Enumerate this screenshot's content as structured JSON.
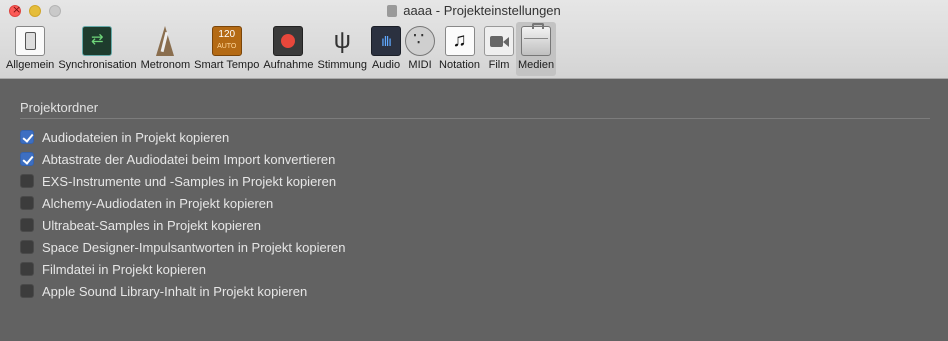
{
  "window": {
    "title": "aaaa - Projekteinstellungen"
  },
  "toolbar": {
    "items": [
      {
        "label": "Allgemein",
        "icon": "general-switch-icon",
        "selected": false
      },
      {
        "label": "Synchronisation",
        "icon": "sync-arrows-icon",
        "selected": false
      },
      {
        "label": "Metronom",
        "icon": "metronome-icon",
        "selected": false
      },
      {
        "label": "Smart Tempo",
        "icon": "smart-tempo-icon",
        "selected": false,
        "badge": "120",
        "badge_sub": "AUTO"
      },
      {
        "label": "Aufnahme",
        "icon": "record-icon",
        "selected": false
      },
      {
        "label": "Stimmung",
        "icon": "tuning-fork-icon",
        "selected": false
      },
      {
        "label": "Audio",
        "icon": "waveform-icon",
        "selected": false
      },
      {
        "label": "MIDI",
        "icon": "midi-connector-icon",
        "selected": false
      },
      {
        "label": "Notation",
        "icon": "music-note-icon",
        "selected": false
      },
      {
        "label": "Film",
        "icon": "camera-icon",
        "selected": false
      },
      {
        "label": "Medien",
        "icon": "briefcase-icon",
        "selected": true
      }
    ]
  },
  "section": {
    "title": "Projektordner",
    "options": [
      {
        "label": "Audiodateien in Projekt kopieren",
        "checked": true
      },
      {
        "label": "Abtastrate der Audiodatei beim Import konvertieren",
        "checked": true
      },
      {
        "label": "EXS-Instrumente und -Samples in Projekt kopieren",
        "checked": false
      },
      {
        "label": "Alchemy-Audiodaten in Projekt kopieren",
        "checked": false
      },
      {
        "label": "Ultrabeat-Samples in Projekt kopieren",
        "checked": false
      },
      {
        "label": "Space Designer-Impulsantworten in Projekt kopieren",
        "checked": false
      },
      {
        "label": "Filmdatei in Projekt kopieren",
        "checked": false
      },
      {
        "label": "Apple Sound Library-Inhalt in Projekt kopieren",
        "checked": false
      }
    ]
  },
  "colors": {
    "background": "#626262",
    "accent": "#3d6fc2",
    "close": "#fc5b57",
    "minimize": "#e5bd3a",
    "maximize_disabled": "#c9c9c9"
  }
}
